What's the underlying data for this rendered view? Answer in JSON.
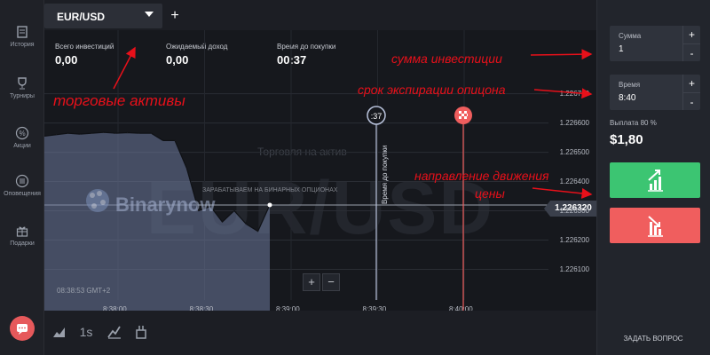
{
  "sidebar": {
    "items": [
      {
        "label": "История",
        "icon": "history-icon"
      },
      {
        "label": "Турниры",
        "icon": "trophy-icon"
      },
      {
        "label": "Акции",
        "icon": "percent-icon"
      },
      {
        "label": "Оповещения",
        "icon": "menu-icon"
      },
      {
        "label": "Подарки",
        "icon": "gift-icon"
      }
    ],
    "chat_icon": "chat-icon"
  },
  "header": {
    "asset_tab": "EUR/USD",
    "add_tab": "+"
  },
  "stats": [
    {
      "label": "Всего инвестиций",
      "value": "0,00"
    },
    {
      "label": "Ожидаемый доход",
      "value": "0,00"
    },
    {
      "label": "Время до покупки",
      "value": "00:37"
    }
  ],
  "chart": {
    "watermark": "EUR/USD",
    "trade_label": "Торговля на актив",
    "logo_text": "Binarynow",
    "logo_sub": "ЗАРАБАТЫВАЕМ НА БИНАРНЫХ ОПЦИОНАХ",
    "purchase_timer": ":37",
    "purchase_line_label": "Время до покупки",
    "current_price": "1.226320",
    "time_display": "08:38:53 GMT+2",
    "zoom_in": "+",
    "zoom_out": "−"
  },
  "chart_data": {
    "type": "area",
    "x_ticks": [
      "8:38:00",
      "8:38:30",
      "8:39:00",
      "8:39:30",
      "8:40:00"
    ],
    "y_ticks": [
      "1.226700",
      "1.226600",
      "1.226500",
      "1.226400",
      "1.226300",
      "1.226200",
      "1.226100"
    ],
    "ylim": [
      1.22605,
      1.22672
    ],
    "series": [
      {
        "values": [
          1.226555,
          1.22656,
          1.226565,
          1.226562,
          1.226565,
          1.226568,
          1.226565,
          1.226567,
          1.226565,
          1.226565,
          1.22654,
          1.22654,
          1.226445,
          1.2263,
          1.226315,
          1.226262,
          1.2263,
          1.226255,
          1.22623,
          1.22632
        ]
      }
    ],
    "grid": true
  },
  "bottom_tools": [
    {
      "icon": "area-chart-icon"
    },
    {
      "label": "1s"
    },
    {
      "icon": "draw-tools-icon"
    },
    {
      "icon": "indicators-icon"
    }
  ],
  "trade_panel": {
    "amount_label": "Сумма",
    "amount_value": "1",
    "time_label": "Время",
    "time_value": "8:40",
    "plus": "+",
    "minus": "-",
    "payout_label": "Выплата 80 %",
    "payout_value": "$1,80",
    "call_icon": "arrow-up-chart-icon",
    "put_icon": "arrow-down-chart-icon",
    "ask_question": "ЗАДАТЬ ВОПРОС"
  },
  "annotations": {
    "assets": "торговые активы",
    "investment": "сумма инвестиции",
    "expiration": "срок экспирации опицона",
    "direction_1": "направление движения",
    "direction_2": "цены"
  },
  "colors": {
    "call": "#3cc572",
    "put": "#f05e5e",
    "annotation": "#e8101a",
    "purchase_line": "#b9c3dc"
  }
}
